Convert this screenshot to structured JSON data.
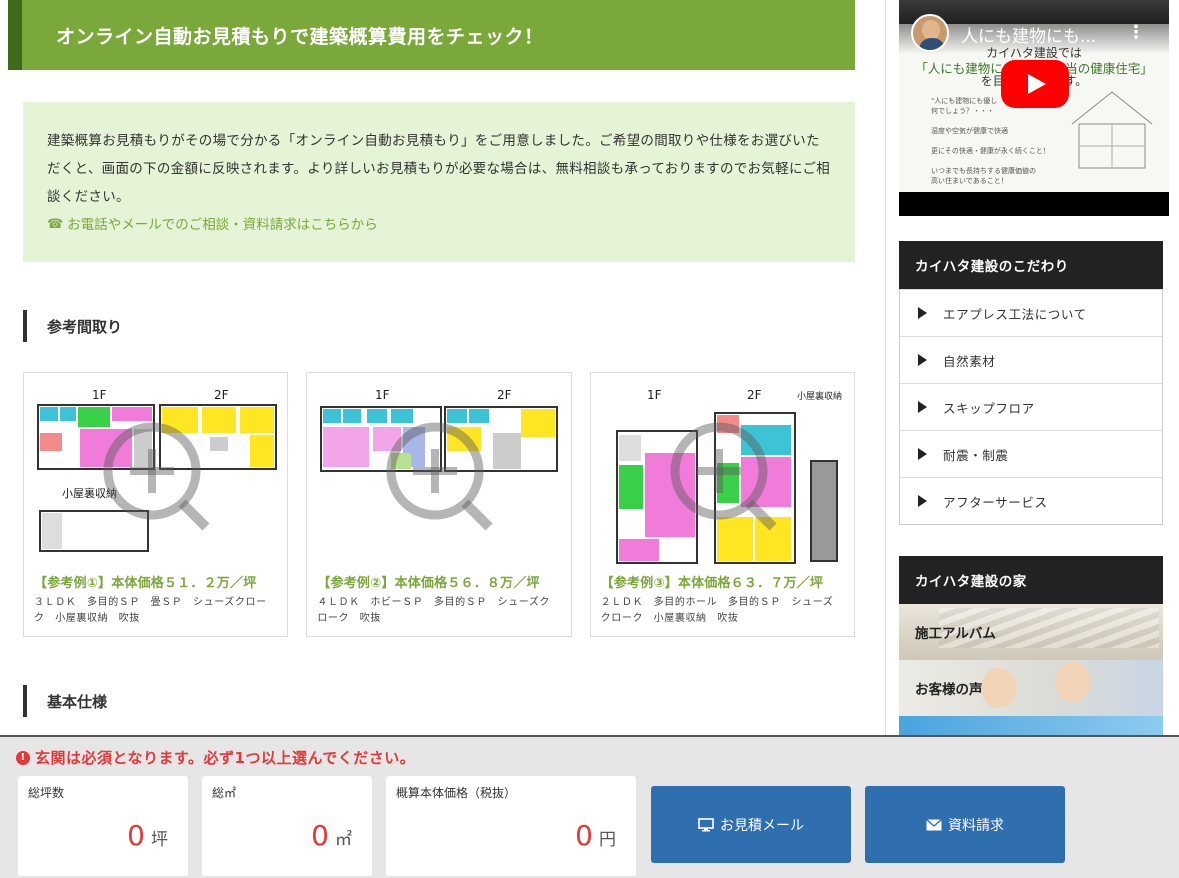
{
  "hero": {
    "title": "オンライン自動お見積もりで建築概算費用をチェック！"
  },
  "intro": {
    "text": "建築概算お見積もりがその場で分かる「オンライン自動お見積もり」をご用意しました。ご希望の間取りや仕様をお選びいただくと、画面の下の金額に反映されます。より詳しいお見積もりが必要な場合は、無料相談も承っておりますのでお気軽にご相談ください。",
    "link_icon": "☎",
    "link": "お電話やメールでのご相談・資料請求はこちらから"
  },
  "sections": {
    "plans_title": "参考間取り",
    "spec_title": "基本仕様"
  },
  "plans": [
    {
      "floor1": "1F",
      "floor2": "2F",
      "extra": "小屋裏収納",
      "title": "【参考例①】本体価格５１．２万／坪",
      "desc": "３ＬＤＫ　多目的ＳＰ　畳ＳＰ　シューズクローク　小屋裏収納　吹抜"
    },
    {
      "floor1": "1F",
      "floor2": "2F",
      "extra": "",
      "title": "【参考例②】本体価格５６．８万／坪",
      "desc": "４ＬＤＫ　ホビーＳＰ　多目的ＳＰ　シューズクローク　吹抜"
    },
    {
      "floor1": "1F",
      "floor2": "2F",
      "extra": "小屋裏収納",
      "title": "【参考例③】本体価格６３．７万／坪",
      "desc": "２ＬＤＫ　多目的ホール　多目的ＳＰ　シューズクローク　小屋裏収納　吹抜"
    }
  ],
  "video": {
    "title": "人にも建物にも...",
    "line1": "カイハタ建設では",
    "line2": "「人にも建物にも優しい本当の健康住宅」",
    "line3": "を目指しています。",
    "small1": "\"人にも建物にも優し",
    "small2": "何でしょう？・・・",
    "small3": "湿度や空気が健康で快適",
    "small4": "更にその快適・健康が永く続くこと！",
    "small5": "いつまでも長持ちする健康価値の",
    "small6": "高い住まいであること！"
  },
  "sidebar": {
    "box1_title": "カイハタ建設のこだわり",
    "items": [
      "エアプレス工法について",
      "自然素材",
      "スキップフロア",
      "耐震・制震",
      "アフターサービス"
    ],
    "box2_title": "カイハタ建設の家",
    "banners": [
      "施工アルバム",
      "お客様の声"
    ]
  },
  "bottom": {
    "alert_icon": "!",
    "alert": "玄関は必須となります。必ず1つ以上選んでください。",
    "fields": [
      {
        "label": "総坪数",
        "value": "0",
        "unit": "坪"
      },
      {
        "label": "総㎡",
        "value": "0",
        "unit": "㎡"
      },
      {
        "label": "概算本体価格（税抜）",
        "value": "0",
        "unit": "円"
      }
    ],
    "buttons": [
      "お見積メール",
      "資料請求"
    ]
  },
  "colors": {
    "brand_green": "#7aa83a",
    "dark_green": "#3f6a1c",
    "intro_bg": "#e5f3d6",
    "alert_red": "#e53838",
    "button_blue": "#2f6eaf"
  }
}
